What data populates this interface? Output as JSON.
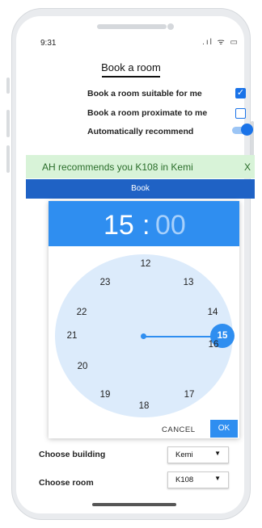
{
  "status": {
    "time": "9:31",
    "icons": ".ıl ᯤ ▭"
  },
  "title": "Book a room",
  "options": [
    {
      "label": "Book a room suitable for me",
      "checked": true
    },
    {
      "label": "Book a room proximate to me",
      "checked": false
    },
    {
      "label": "Automatically recommend",
      "toggle_on": true
    }
  ],
  "recommendation": {
    "text": "AH recommends you K108 in Kemi",
    "close": "X"
  },
  "book_button": "Book",
  "time_picker": {
    "hour": "15",
    "colon": ":",
    "minute": "00",
    "numbers": [
      "12",
      "13",
      "14",
      "15",
      "16",
      "17",
      "18",
      "19",
      "20",
      "21",
      "22",
      "23"
    ],
    "selected": "15",
    "cancel": "CANCEL",
    "ok": "OK"
  },
  "building": {
    "label": "Choose building",
    "value": "Kemi"
  },
  "room": {
    "label": "Choose room",
    "value": "K108"
  },
  "icons": {
    "dropdown": "caret-down-icon",
    "checkmark": "check-icon"
  },
  "colors": {
    "accent": "#2f8ef0",
    "book_bar": "#1f62c5",
    "recommend_bg": "#d8f3d8",
    "recommend_text": "#2a6d2a"
  }
}
